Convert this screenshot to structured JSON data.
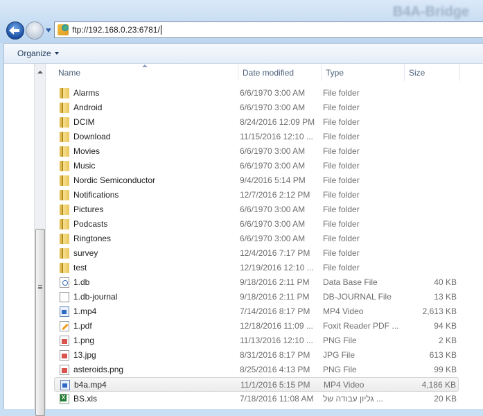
{
  "window": {
    "title": "B4A-Bridge"
  },
  "address_bar": {
    "value": "ftp://192.168.0.23:6781/",
    "icon": "ftp-globe-icon"
  },
  "toolbar": {
    "organize_label": "Organize"
  },
  "columns": {
    "name": "Name",
    "date": "Date modified",
    "type": "Type",
    "size": "Size"
  },
  "files": [
    {
      "name": "Alarms",
      "date": "6/6/1970 3:00 AM",
      "type": "File folder",
      "size": "",
      "icon": "folder"
    },
    {
      "name": "Android",
      "date": "6/6/1970 3:00 AM",
      "type": "File folder",
      "size": "",
      "icon": "folder"
    },
    {
      "name": "DCIM",
      "date": "8/24/2016 12:09 PM",
      "type": "File folder",
      "size": "",
      "icon": "folder"
    },
    {
      "name": "Download",
      "date": "11/15/2016 12:10 ...",
      "type": "File folder",
      "size": "",
      "icon": "folder"
    },
    {
      "name": "Movies",
      "date": "6/6/1970 3:00 AM",
      "type": "File folder",
      "size": "",
      "icon": "folder"
    },
    {
      "name": "Music",
      "date": "6/6/1970 3:00 AM",
      "type": "File folder",
      "size": "",
      "icon": "folder"
    },
    {
      "name": "Nordic Semiconductor",
      "date": "9/4/2016 5:14 PM",
      "type": "File folder",
      "size": "",
      "icon": "folder"
    },
    {
      "name": "Notifications",
      "date": "12/7/2016 2:12 PM",
      "type": "File folder",
      "size": "",
      "icon": "folder"
    },
    {
      "name": "Pictures",
      "date": "6/6/1970 3:00 AM",
      "type": "File folder",
      "size": "",
      "icon": "folder"
    },
    {
      "name": "Podcasts",
      "date": "6/6/1970 3:00 AM",
      "type": "File folder",
      "size": "",
      "icon": "folder"
    },
    {
      "name": "Ringtones",
      "date": "6/6/1970 3:00 AM",
      "type": "File folder",
      "size": "",
      "icon": "folder"
    },
    {
      "name": "survey",
      "date": "12/4/2016 7:17 PM",
      "type": "File folder",
      "size": "",
      "icon": "folder"
    },
    {
      "name": "test",
      "date": "12/19/2016 12:10 ...",
      "type": "File folder",
      "size": "",
      "icon": "folder"
    },
    {
      "name": "1.db",
      "date": "9/18/2016 2:11 PM",
      "type": "Data Base File",
      "size": "40 KB",
      "icon": "db"
    },
    {
      "name": "1.db-journal",
      "date": "9/18/2016 2:11 PM",
      "type": "DB-JOURNAL File",
      "size": "13 KB",
      "icon": "file"
    },
    {
      "name": "1.mp4",
      "date": "7/14/2016 8:17 PM",
      "type": "MP4 Video",
      "size": "2,613 KB",
      "icon": "mp4"
    },
    {
      "name": "1.pdf",
      "date": "12/18/2016 11:09 ...",
      "type": "Foxit Reader PDF ...",
      "size": "94 KB",
      "icon": "pdf"
    },
    {
      "name": "1.png",
      "date": "11/13/2016 12:10 ...",
      "type": "PNG File",
      "size": "2 KB",
      "icon": "img"
    },
    {
      "name": "13.jpg",
      "date": "8/31/2016 8:17 PM",
      "type": "JPG File",
      "size": "613 KB",
      "icon": "img"
    },
    {
      "name": "asteroids.png",
      "date": "8/25/2016 4:13 PM",
      "type": "PNG File",
      "size": "99 KB",
      "icon": "img"
    },
    {
      "name": "b4a.mp4",
      "date": "11/1/2016 5:15 PM",
      "type": "MP4 Video",
      "size": "4,186 KB",
      "icon": "mp4",
      "selected": true
    },
    {
      "name": "BS.xls",
      "date": "7/18/2016 11:08 AM",
      "type": "גליון עבודה של ...",
      "size": "20 KB",
      "icon": "xls"
    }
  ]
}
